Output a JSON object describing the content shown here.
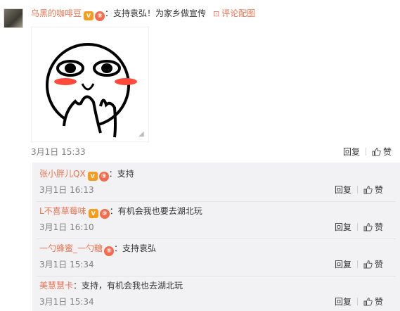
{
  "main_comment": {
    "username": "乌黑的咖啡豆",
    "badge_v": "V",
    "badge_level": "⑨",
    "separator": "：",
    "text": "支持袁弘！为家乡做宣传",
    "link_icon": "picture-icon",
    "link_label": "评论配图",
    "time": "3月1日 15:33",
    "reply_label": "回复",
    "like_label": "赞"
  },
  "replies": [
    {
      "username": "张小胖儿QX",
      "badges": [
        "V",
        "⑨"
      ],
      "separator": "：",
      "text": "支持",
      "time": "3月1日 16:13",
      "reply_label": "回复",
      "like_label": "赞"
    },
    {
      "username": "L不喜草莓味",
      "badges": [
        "V",
        "⑨"
      ],
      "separator": "：",
      "text": "有机会我也要去湖北玩",
      "time": "3月1日 16:10",
      "reply_label": "回复",
      "like_label": "赞"
    },
    {
      "username": "一勺蜂蜜_一勺糖",
      "badges": [
        "⑨"
      ],
      "separator": "：",
      "text": "支持袁弘",
      "time": "3月1日 15:34",
      "reply_label": "回复",
      "like_label": "赞"
    },
    {
      "username": "美慧慧卡",
      "badges": [],
      "separator": "：",
      "text": "支持，有机会我也去湖北玩",
      "time": "3月1日 15:34",
      "reply_label": "回复",
      "like_label": "赞"
    }
  ],
  "colors": {
    "username": "#eb7350",
    "reply_bg": "#f2f2f5",
    "badge_v": "#f79c1d",
    "badge_level": "#f36b4b",
    "meme_blush": "#ff4a3a"
  }
}
